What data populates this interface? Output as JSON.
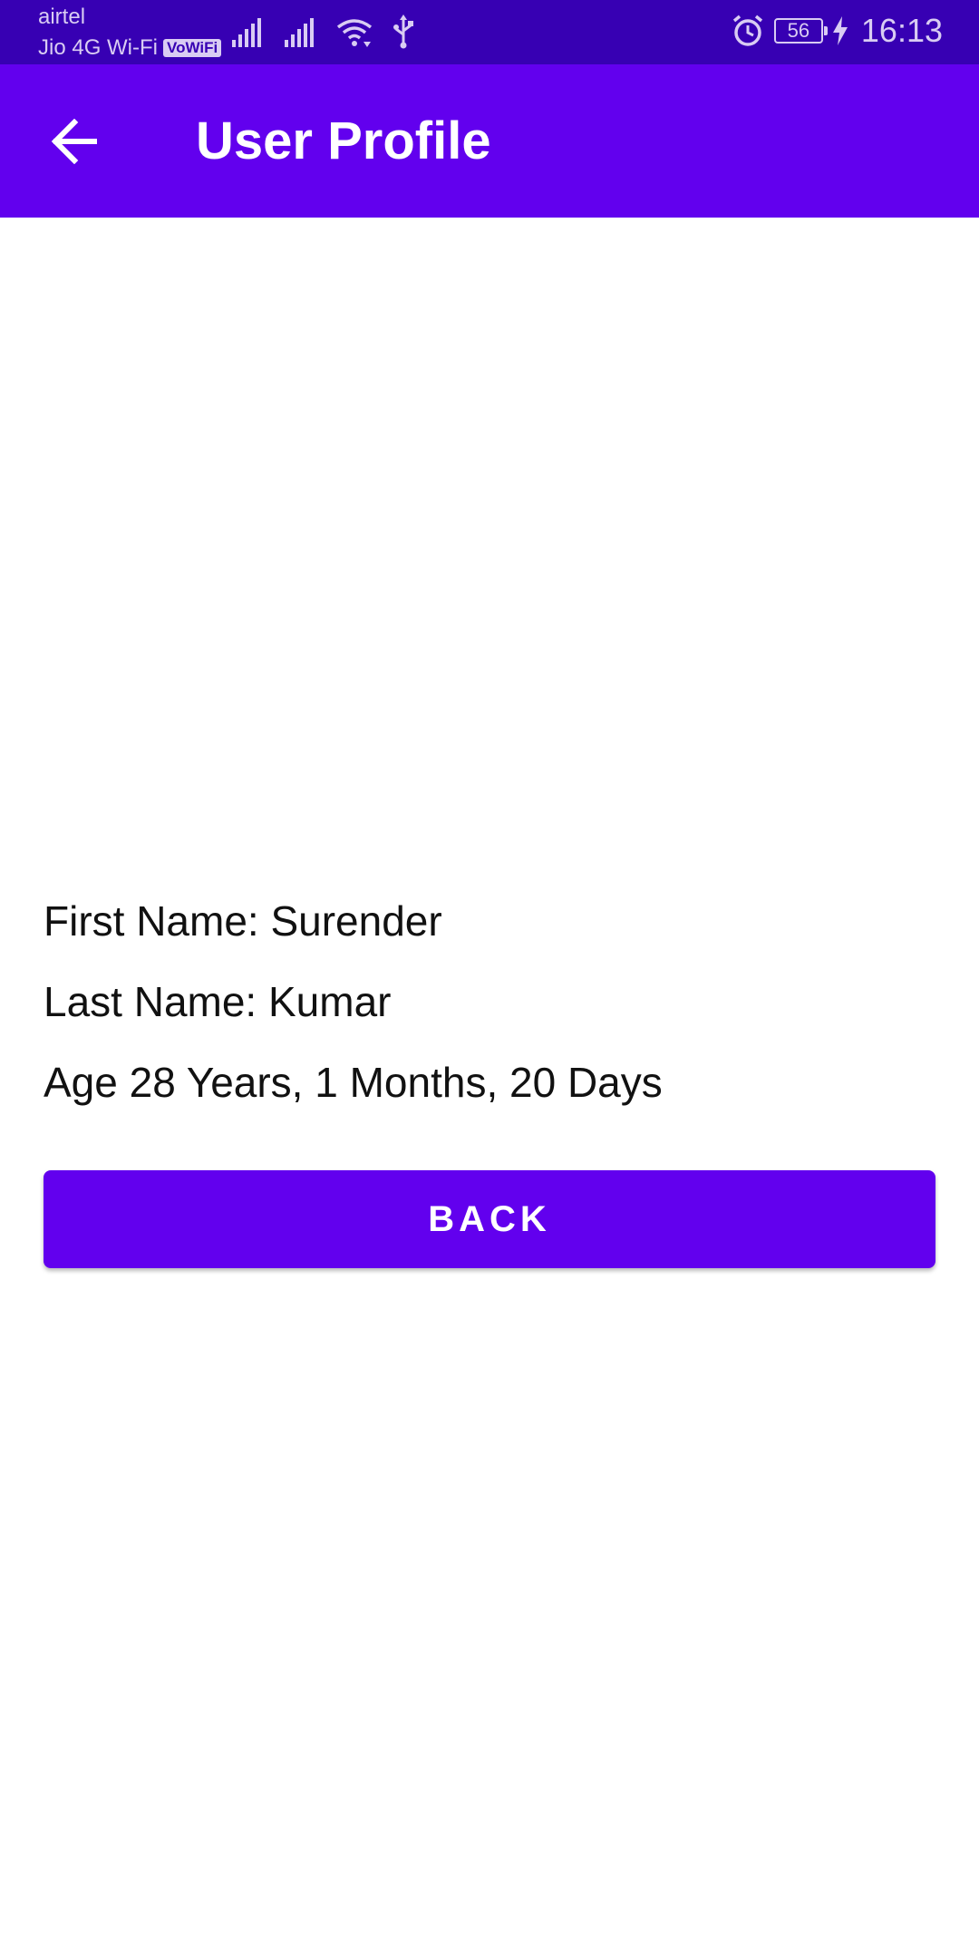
{
  "status_bar": {
    "carrier_1": "airtel",
    "carrier_2": "Jio 4G Wi-Fi",
    "vowifi_badge": "VoWiFi",
    "battery_level": "56",
    "time": "16:13",
    "color": "#3700b3"
  },
  "app_bar": {
    "back_icon": "arrow-back-icon",
    "title": "User Profile",
    "color": "#6200ee"
  },
  "profile": {
    "first_name_line": "First Name: Surender",
    "last_name_line": "Last Name: Kumar",
    "age_line": "Age 28 Years, 1 Months, 20 Days"
  },
  "actions": {
    "back_button_label": "BACK"
  }
}
